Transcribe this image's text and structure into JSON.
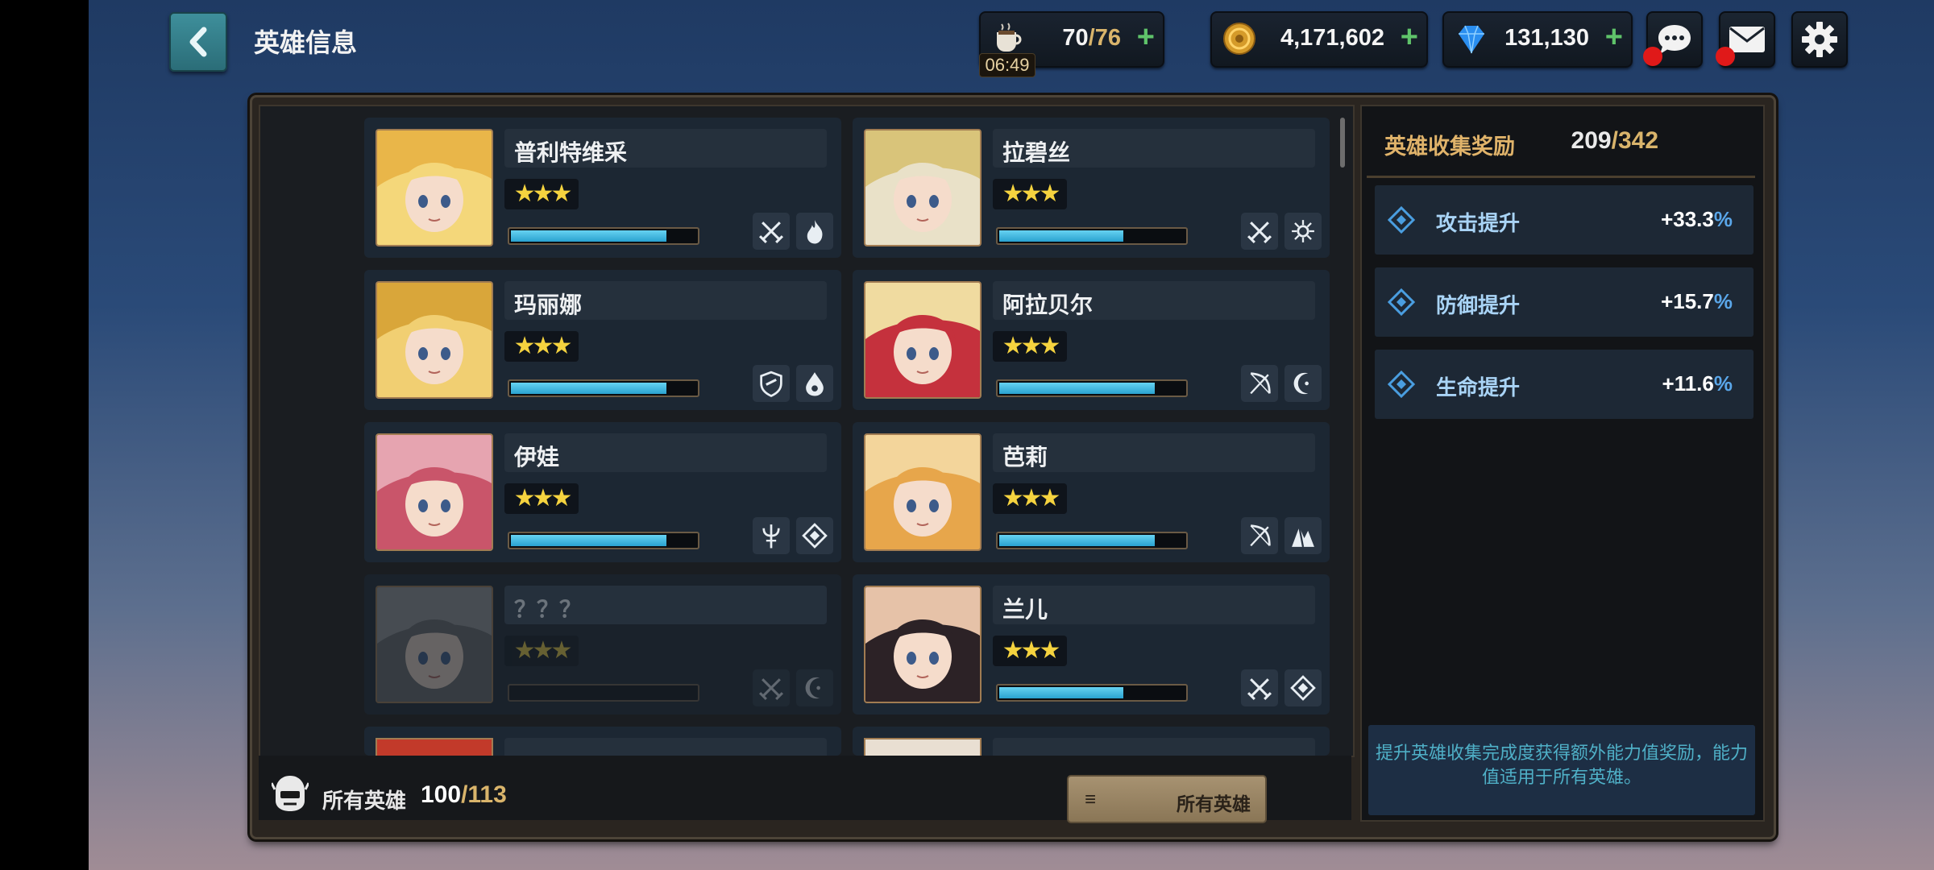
{
  "header": {
    "title": "英雄信息",
    "stamina": {
      "current": "70",
      "max": "/76",
      "timer": "06:49",
      "icon": "coffee-cup-icon"
    },
    "gold": {
      "value": "4,171,602",
      "icon": "gold-coin-icon"
    },
    "gems": {
      "value": "131,130",
      "icon": "blue-diamond-icon"
    },
    "plus": "+",
    "buttons": [
      "chat-icon",
      "mail-icon",
      "settings-gear-icon"
    ]
  },
  "heroes": [
    {
      "name": "普利特维采",
      "stars": "★★★",
      "exp": 0.84,
      "badges": [
        "crossed-swords-icon",
        "fire-element-icon"
      ]
    },
    {
      "name": "拉碧丝",
      "stars": "★★★",
      "exp": 0.67,
      "badges": [
        "crossed-swords-icon",
        "light-element-icon"
      ]
    },
    {
      "name": "玛丽娜",
      "stars": "★★★",
      "exp": 0.84,
      "badges": [
        "shield-class-icon",
        "water-element-icon"
      ]
    },
    {
      "name": "阿拉贝尔",
      "stars": "★★★",
      "exp": 0.84,
      "badges": [
        "bow-class-icon",
        "dark-moon-element-icon"
      ]
    },
    {
      "name": "伊娃",
      "stars": "★★★",
      "exp": 0.84,
      "badges": [
        "staff-class-icon",
        "diamond-element-icon"
      ]
    },
    {
      "name": "芭莉",
      "stars": "★★★",
      "exp": 0.84,
      "badges": [
        "bow-class-icon",
        "earth-element-icon"
      ]
    },
    {
      "name": "？？？",
      "stars": "★★★",
      "exp": 0.0,
      "locked": true,
      "badges": [
        "crossed-swords-icon",
        "dark-moon-element-icon"
      ]
    },
    {
      "name": "兰儿",
      "stars": "★★★",
      "exp": 0.67,
      "badges": [
        "crossed-swords-icon",
        "diamond-element-icon"
      ]
    }
  ],
  "footer": {
    "all_label": "所有英雄",
    "count": "100",
    "total": "/113",
    "filter_label": "所有英雄",
    "filter_icon": "≡"
  },
  "rewards": {
    "title": "英雄收集奖励",
    "count": "209",
    "total": "/342",
    "items": [
      {
        "label": "攻击提升",
        "value": "+33.3",
        "pct": "%"
      },
      {
        "label": "防御提升",
        "value": "+15.7",
        "pct": "%"
      },
      {
        "label": "生命提升",
        "value": "+11.6",
        "pct": "%"
      }
    ],
    "info": "提升英雄收集完成度获得额外能力值奖励，能力值适用于所有英雄。"
  },
  "colors": {
    "accent_gold": "#d9b46b",
    "exp_blue": "#3bb6e2",
    "plus_green": "#5fc36a",
    "alert_red": "#e01919"
  }
}
